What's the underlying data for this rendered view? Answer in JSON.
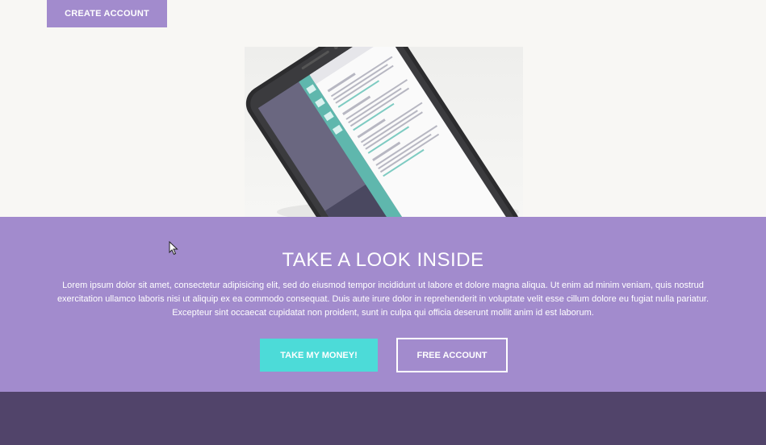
{
  "header": {
    "create_account_label": "CREATE ACCOUNT"
  },
  "hero": {
    "image_icon": "phone-app-mockup"
  },
  "cta": {
    "title": "TAKE A LOOK INSIDE",
    "body": "Lorem ipsum dolor sit amet, consectetur adipisicing elit, sed do eiusmod tempor incididunt ut labore et dolore magna aliqua. Ut enim ad minim veniam, quis nostrud exercitation ullamco laboris nisi ut aliquip ex ea commodo consequat. Duis aute irure dolor in reprehenderit in voluptate velit esse cillum dolore eu fugiat nulla pariatur. Excepteur sint occaecat cupidatat non proident, sunt in culpa qui officia deserunt mollit anim id est laborum.",
    "primary_button_label": "TAKE MY MONEY!",
    "secondary_button_label": "FREE ACCOUNT"
  },
  "colors": {
    "accent_purple": "#a28bcd",
    "accent_teal": "#4cdbd8",
    "footer_dark": "#51446a",
    "page_bg": "#f8f7f4"
  }
}
